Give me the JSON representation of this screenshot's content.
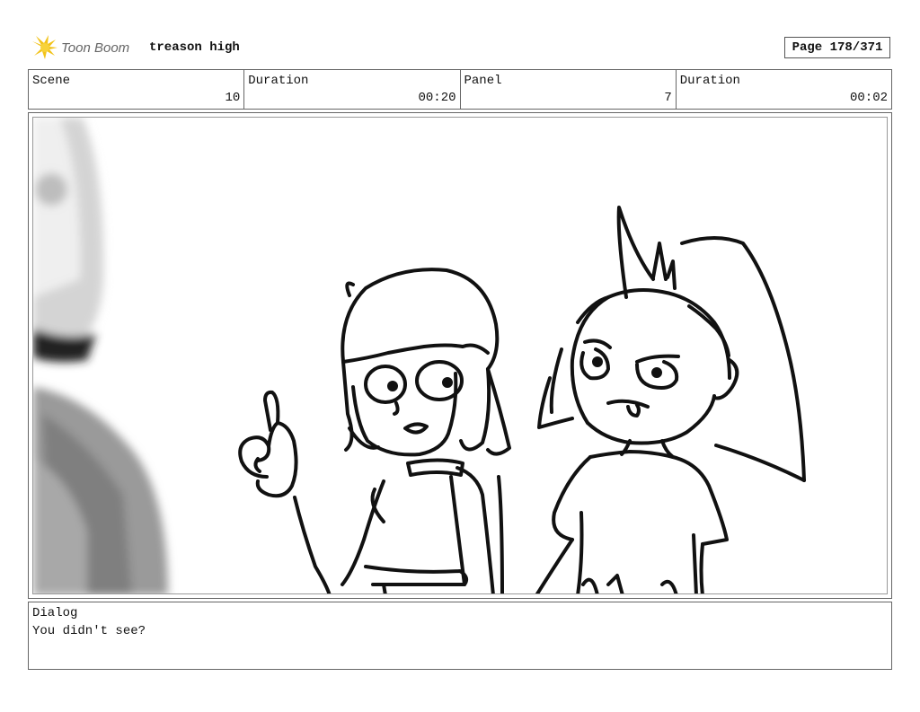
{
  "header": {
    "logo_text": "Toon Boom",
    "project_title": "treason high",
    "page": "Page 178/371"
  },
  "info": {
    "scene_label": "Scene",
    "scene_value": "10",
    "scene_duration_label": "Duration",
    "scene_duration_value": "00:20",
    "panel_label": "Panel",
    "panel_value": "7",
    "panel_duration_label": "Duration",
    "panel_duration_value": "00:02"
  },
  "dialog": {
    "label": "Dialog",
    "text": "You didn't see?"
  }
}
